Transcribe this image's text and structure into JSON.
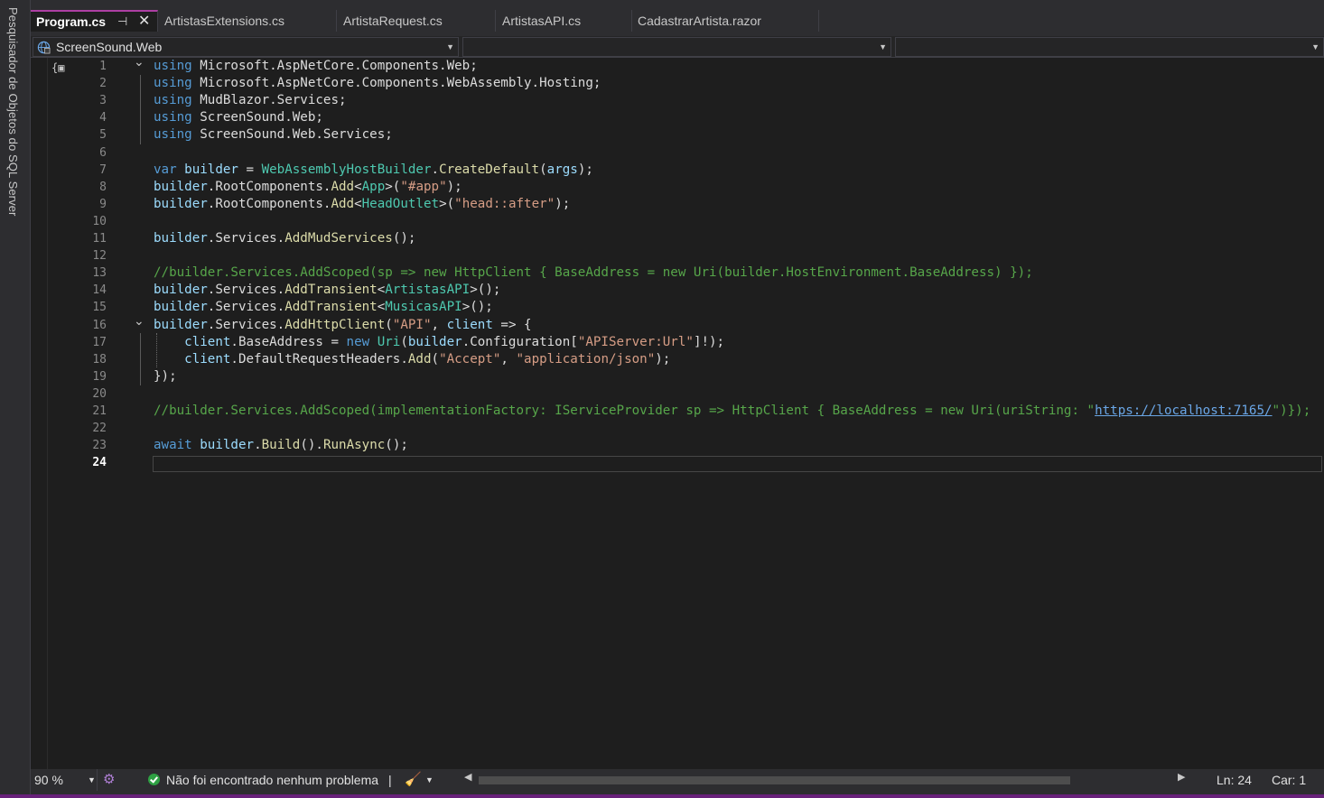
{
  "side_panel": {
    "label": "Pesquisador de Objetos do SQL Server"
  },
  "tabs": [
    {
      "label": "Program.cs",
      "active": true
    },
    {
      "label": "ArtistasExtensions.cs",
      "active": false
    },
    {
      "label": "ArtistaRequest.cs",
      "active": false
    },
    {
      "label": "ArtistasAPI.cs",
      "active": false
    },
    {
      "label": "CadastrarArtista.razor",
      "active": false
    }
  ],
  "tab_actions": {
    "pin_icon": "pin-icon",
    "close_icon": "close-icon"
  },
  "navbar": {
    "project": "ScreenSound.Web",
    "type_member": "",
    "member": ""
  },
  "code_lines": [
    {
      "n": "1",
      "segs": [
        [
          "kw",
          "using"
        ],
        [
          "pl",
          " Microsoft.AspNetCore.Components.Web;"
        ]
      ]
    },
    {
      "n": "2",
      "segs": [
        [
          "kw",
          "using"
        ],
        [
          "pl",
          " Microsoft.AspNetCore.Components.WebAssembly.Hosting;"
        ]
      ]
    },
    {
      "n": "3",
      "segs": [
        [
          "kw",
          "using"
        ],
        [
          "pl",
          " MudBlazor.Services;"
        ]
      ]
    },
    {
      "n": "4",
      "segs": [
        [
          "kw",
          "using"
        ],
        [
          "pl",
          " ScreenSound.Web;"
        ]
      ]
    },
    {
      "n": "5",
      "segs": [
        [
          "kw",
          "using"
        ],
        [
          "pl",
          " ScreenSound.Web.Services;"
        ]
      ]
    },
    {
      "n": "6",
      "segs": []
    },
    {
      "n": "7",
      "segs": [
        [
          "kw",
          "var"
        ],
        [
          "pl",
          " "
        ],
        [
          "vr",
          "builder"
        ],
        [
          "pl",
          " = "
        ],
        [
          "ty",
          "WebAssemblyHostBuilder"
        ],
        [
          "pl",
          "."
        ],
        [
          "fn",
          "CreateDefault"
        ],
        [
          "pl",
          "("
        ],
        [
          "vr",
          "args"
        ],
        [
          "pl",
          ");"
        ]
      ]
    },
    {
      "n": "8",
      "segs": [
        [
          "vr",
          "builder"
        ],
        [
          "pl",
          ".RootComponents."
        ],
        [
          "fn",
          "Add"
        ],
        [
          "pl",
          "<"
        ],
        [
          "ty",
          "App"
        ],
        [
          "pl",
          ">("
        ],
        [
          "st",
          "\"#app\""
        ],
        [
          "pl",
          ");"
        ]
      ]
    },
    {
      "n": "9",
      "segs": [
        [
          "vr",
          "builder"
        ],
        [
          "pl",
          ".RootComponents."
        ],
        [
          "fn",
          "Add"
        ],
        [
          "pl",
          "<"
        ],
        [
          "ty",
          "HeadOutlet"
        ],
        [
          "pl",
          ">("
        ],
        [
          "st",
          "\"head::after\""
        ],
        [
          "pl",
          ");"
        ]
      ]
    },
    {
      "n": "10",
      "segs": []
    },
    {
      "n": "11",
      "segs": [
        [
          "vr",
          "builder"
        ],
        [
          "pl",
          ".Services."
        ],
        [
          "fn",
          "AddMudServices"
        ],
        [
          "pl",
          "();"
        ]
      ]
    },
    {
      "n": "12",
      "segs": []
    },
    {
      "n": "13",
      "segs": [
        [
          "cm",
          "//builder.Services.AddScoped(sp => new HttpClient { BaseAddress = new Uri(builder.HostEnvironment.BaseAddress) });"
        ]
      ]
    },
    {
      "n": "14",
      "segs": [
        [
          "vr",
          "builder"
        ],
        [
          "pl",
          ".Services."
        ],
        [
          "fn",
          "AddTransient"
        ],
        [
          "pl",
          "<"
        ],
        [
          "ty",
          "ArtistasAPI"
        ],
        [
          "pl",
          ">();"
        ]
      ]
    },
    {
      "n": "15",
      "segs": [
        [
          "vr",
          "builder"
        ],
        [
          "pl",
          ".Services."
        ],
        [
          "fn",
          "AddTransient"
        ],
        [
          "pl",
          "<"
        ],
        [
          "ty",
          "MusicasAPI"
        ],
        [
          "pl",
          ">();"
        ]
      ]
    },
    {
      "n": "16",
      "segs": [
        [
          "vr",
          "builder"
        ],
        [
          "pl",
          ".Services."
        ],
        [
          "fn",
          "AddHttpClient"
        ],
        [
          "pl",
          "("
        ],
        [
          "st",
          "\"API\""
        ],
        [
          "pl",
          ", "
        ],
        [
          "vr",
          "client"
        ],
        [
          "pl",
          " => {"
        ]
      ]
    },
    {
      "n": "17",
      "segs": [
        [
          "pl",
          "    "
        ],
        [
          "vr",
          "client"
        ],
        [
          "pl",
          ".BaseAddress = "
        ],
        [
          "kw",
          "new"
        ],
        [
          "pl",
          " "
        ],
        [
          "ty",
          "Uri"
        ],
        [
          "pl",
          "("
        ],
        [
          "vr",
          "builder"
        ],
        [
          "pl",
          ".Configuration["
        ],
        [
          "st",
          "\"APIServer:Url\""
        ],
        [
          "pl",
          "]!);"
        ]
      ]
    },
    {
      "n": "18",
      "segs": [
        [
          "pl",
          "    "
        ],
        [
          "vr",
          "client"
        ],
        [
          "pl",
          ".DefaultRequestHeaders."
        ],
        [
          "fn",
          "Add"
        ],
        [
          "pl",
          "("
        ],
        [
          "st",
          "\"Accept\""
        ],
        [
          "pl",
          ", "
        ],
        [
          "st",
          "\"application/json\""
        ],
        [
          "pl",
          ");"
        ]
      ]
    },
    {
      "n": "19",
      "segs": [
        [
          "pl",
          "});"
        ]
      ]
    },
    {
      "n": "20",
      "segs": []
    },
    {
      "n": "21",
      "segs": [
        [
          "cm",
          "//builder.Services.AddScoped(implementationFactory: IServiceProvider sp => HttpClient { BaseAddress = new Uri(uriString: \""
        ],
        [
          "lk",
          "https://localhost:7165/"
        ],
        [
          "cm",
          "\")});"
        ]
      ]
    },
    {
      "n": "22",
      "segs": []
    },
    {
      "n": "23",
      "segs": [
        [
          "kw",
          "await"
        ],
        [
          "pl",
          " "
        ],
        [
          "vr",
          "builder"
        ],
        [
          "pl",
          "."
        ],
        [
          "fn",
          "Build"
        ],
        [
          "pl",
          "()."
        ],
        [
          "fn",
          "RunAsync"
        ],
        [
          "pl",
          "();"
        ]
      ]
    },
    {
      "n": "24",
      "segs": []
    }
  ],
  "current_line": "24",
  "fold_markers": [
    "1",
    "16"
  ],
  "colors": {
    "keyword": "#569cd6",
    "type": "#4ec9b0",
    "method": "#dcdcaa",
    "string": "#d69d85",
    "comment": "#57a64a",
    "variable": "#9cdcfe",
    "accent": "#68217a",
    "active_tab_border": "#ad3fa3"
  },
  "statusbar": {
    "zoom": "90 %",
    "issues": "Não foi encontrado nenhum problema",
    "line": "Ln: 24",
    "col": "Car: 1"
  }
}
